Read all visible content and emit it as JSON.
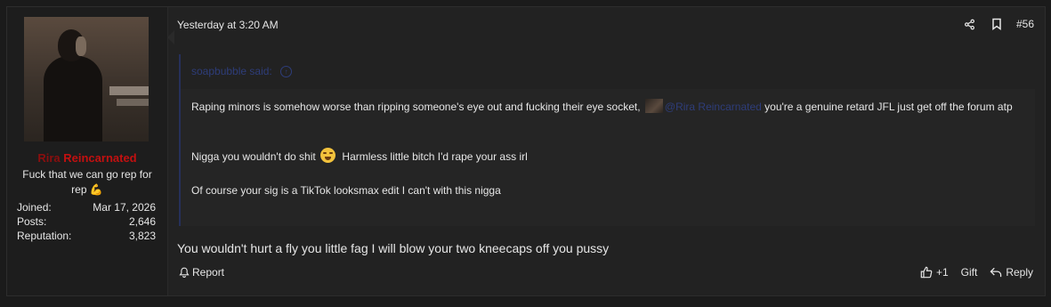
{
  "user": {
    "name_part1": "Rira",
    "name_part2": "Reincarnated",
    "title": "Fuck that we can go rep for rep",
    "title_emoji": "💪",
    "stats": [
      {
        "label": "Joined:",
        "value": "Mar 17, 2026"
      },
      {
        "label": "Posts:",
        "value": "2,646"
      },
      {
        "label": "Reputation:",
        "value": "3,823"
      }
    ],
    "colors": {
      "name_dark": "#8b0e0e",
      "name_light": "#c31010"
    }
  },
  "post": {
    "date": "Yesterday at 3:20 AM",
    "number": "#56",
    "message": "You wouldn't hurt a fly you little fag I will blow your two kneecaps off you pussy"
  },
  "quote": {
    "author_label": "soapbubble said:",
    "line1_part1": "Raping minors is somehow worse than ripping someone's eye out and fucking their eye socket,",
    "mention": "@Rira Reincarnated",
    "line1_part2": "you're a genuine retard JFL just get off the forum atp",
    "line2_part1": "Nigga you wouldn't do shit",
    "line2_part2": "Harmless little bitch I'd rape your ass irl",
    "line3": "Of course your sig is a TikTok looksmax edit I can't with this nigga",
    "accent_color": "#2e3d7a"
  },
  "actions": {
    "report": "Report",
    "reaction_count": "+1",
    "gift": "Gift",
    "reply": "Reply"
  },
  "icons": [
    "share-icon",
    "bookmark-icon",
    "bell-icon",
    "thumbs-up-icon",
    "reply-arrow-icon",
    "arrow-up-circle-icon",
    "grimace-emoji-icon"
  ]
}
